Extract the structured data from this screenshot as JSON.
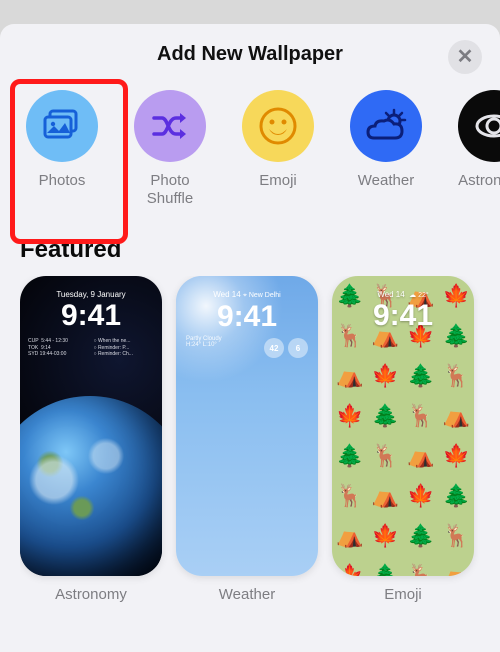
{
  "header": {
    "title": "Add New Wallpaper"
  },
  "categories": [
    {
      "id": "photos",
      "label": "Photos"
    },
    {
      "id": "photo-shuffle",
      "label": "Photo Shuffle"
    },
    {
      "id": "emoji",
      "label": "Emoji"
    },
    {
      "id": "weather",
      "label": "Weather"
    },
    {
      "id": "astronomy",
      "label": "Astronomy"
    }
  ],
  "featured": {
    "heading": "Featured",
    "items": [
      {
        "id": "astronomy",
        "label": "Astronomy",
        "lock_date": "Tuesday, 9 January",
        "lock_time": "9:41",
        "widgets_left": "CUP  5:44 - 12:30\nTOK  9:14\nSYD 19:44-03:00",
        "widgets_right": "○ When the ne...\n○ Reminder: P...\n○ Reminder: Ch..."
      },
      {
        "id": "weather",
        "label": "Weather",
        "lock_date_prefix": "Wed 14",
        "lock_location": "⌖ New Delhi",
        "lock_time": "9:41",
        "sub1": "Partly Cloudy",
        "sub2": "H:24° L:10°",
        "badge1": "42",
        "badge2": "6"
      },
      {
        "id": "emoji",
        "label": "Emoji",
        "lock_date": "Wed 14",
        "lock_temp": "☁ 22°",
        "lock_time": "9:41",
        "pattern": [
          "🌲",
          "🦌",
          "⛺",
          "🍁",
          "🦌",
          "⛺",
          "🍁",
          "🌲",
          "⛺",
          "🍁",
          "🌲",
          "🦌",
          "🍁",
          "🌲",
          "🦌",
          "⛺",
          "🌲",
          "🦌",
          "⛺",
          "🍁",
          "🦌",
          "⛺",
          "🍁",
          "🌲",
          "⛺",
          "🍁",
          "🌲",
          "🦌",
          "🍁",
          "🌲",
          "🦌",
          "⛺"
        ]
      }
    ]
  },
  "highlight": {
    "target": "photos"
  }
}
